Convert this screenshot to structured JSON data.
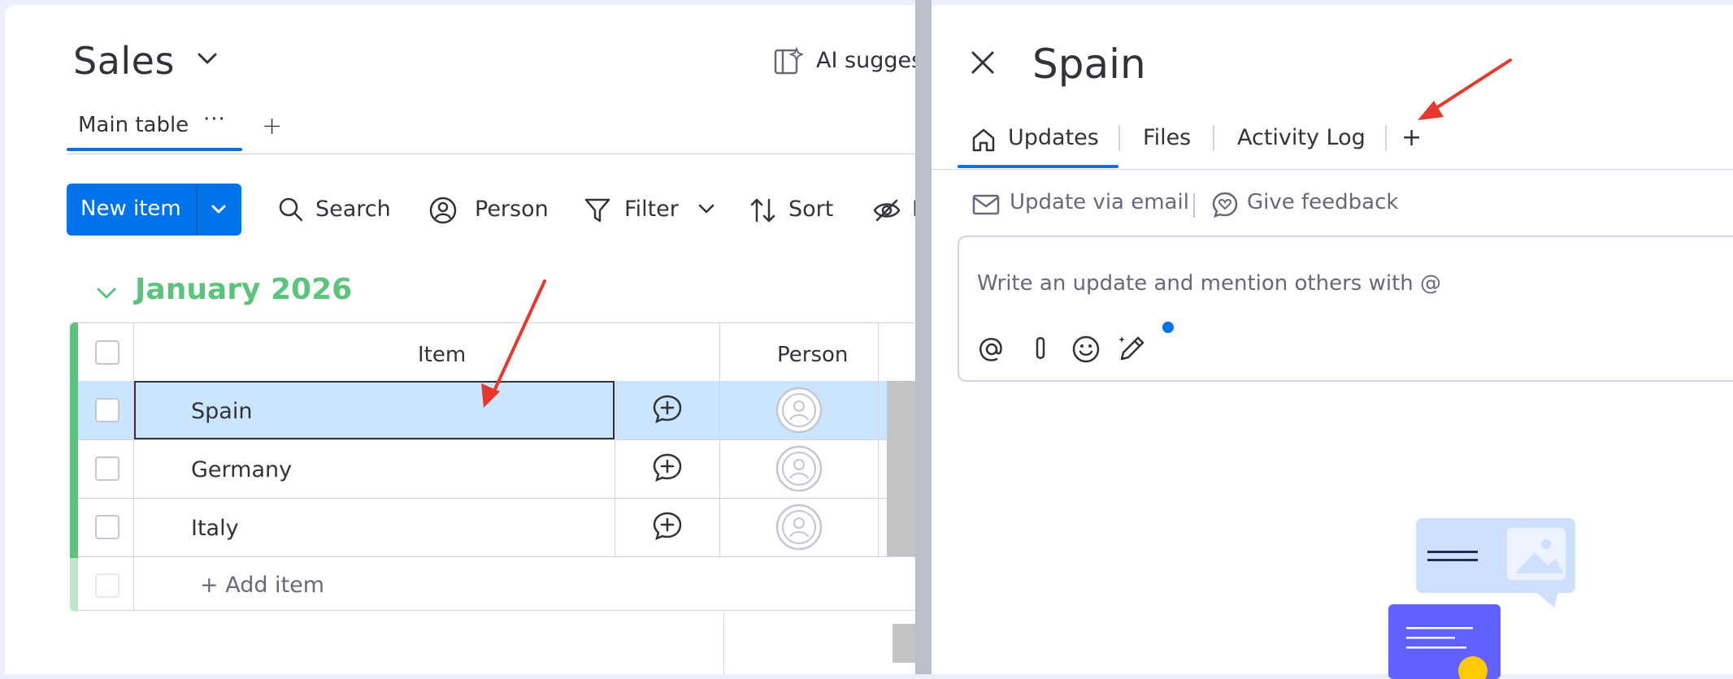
{
  "board": {
    "title": "Sales",
    "ai_label": "AI sugges",
    "views": [
      {
        "label": "Main table",
        "more": "···"
      }
    ],
    "add_view": "+"
  },
  "toolbar": {
    "new_item": "New item",
    "search": "Search",
    "person": "Person",
    "filter": "Filter",
    "sort": "Sort",
    "hide": "H"
  },
  "group": {
    "title": "January 2026",
    "color": "#5ac47d",
    "columns": {
      "item": "Item",
      "person": "Person"
    },
    "rows": [
      {
        "name": "Spain",
        "selected": true
      },
      {
        "name": "Germany",
        "selected": false
      },
      {
        "name": "Italy",
        "selected": false
      }
    ],
    "add_item": "+ Add item"
  },
  "panel": {
    "title": "Spain",
    "tabs": [
      {
        "label": "Updates",
        "active": true
      },
      {
        "label": "Files",
        "active": false
      },
      {
        "label": "Activity Log",
        "active": false
      }
    ],
    "add_tab": "+",
    "links": {
      "email": "Update via email",
      "feedback": "Give feedback"
    },
    "editor_placeholder": "Write an update and mention others with @"
  },
  "colors": {
    "accent": "#0073ea",
    "selected_row": "#cce5ff",
    "annotation_arrow": "#e8372b"
  }
}
